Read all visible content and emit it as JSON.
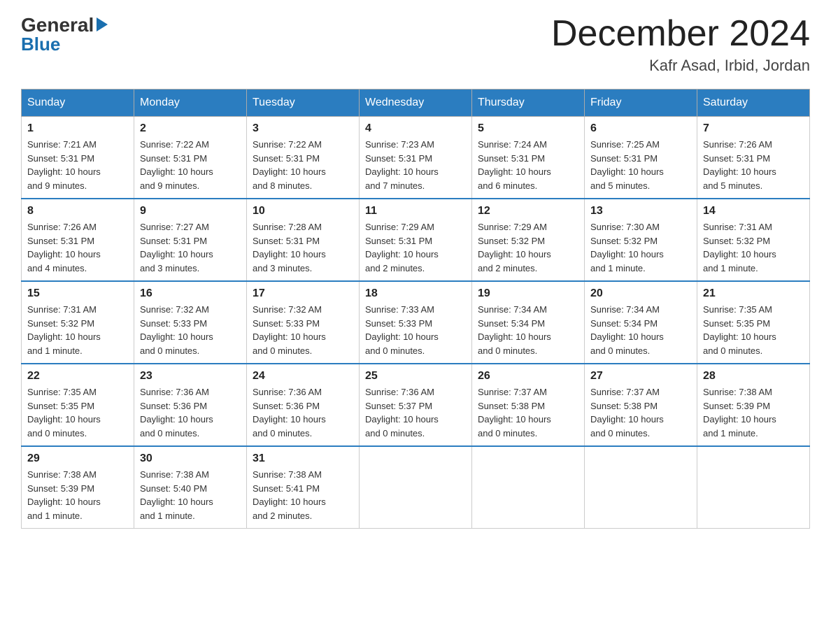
{
  "logo": {
    "general": "General",
    "blue": "Blue"
  },
  "title": "December 2024",
  "location": "Kafr Asad, Irbid, Jordan",
  "days_of_week": [
    "Sunday",
    "Monday",
    "Tuesday",
    "Wednesday",
    "Thursday",
    "Friday",
    "Saturday"
  ],
  "weeks": [
    [
      {
        "day": "1",
        "sunrise": "7:21 AM",
        "sunset": "5:31 PM",
        "daylight": "10 hours and 9 minutes."
      },
      {
        "day": "2",
        "sunrise": "7:22 AM",
        "sunset": "5:31 PM",
        "daylight": "10 hours and 9 minutes."
      },
      {
        "day": "3",
        "sunrise": "7:22 AM",
        "sunset": "5:31 PM",
        "daylight": "10 hours and 8 minutes."
      },
      {
        "day": "4",
        "sunrise": "7:23 AM",
        "sunset": "5:31 PM",
        "daylight": "10 hours and 7 minutes."
      },
      {
        "day": "5",
        "sunrise": "7:24 AM",
        "sunset": "5:31 PM",
        "daylight": "10 hours and 6 minutes."
      },
      {
        "day": "6",
        "sunrise": "7:25 AM",
        "sunset": "5:31 PM",
        "daylight": "10 hours and 5 minutes."
      },
      {
        "day": "7",
        "sunrise": "7:26 AM",
        "sunset": "5:31 PM",
        "daylight": "10 hours and 5 minutes."
      }
    ],
    [
      {
        "day": "8",
        "sunrise": "7:26 AM",
        "sunset": "5:31 PM",
        "daylight": "10 hours and 4 minutes."
      },
      {
        "day": "9",
        "sunrise": "7:27 AM",
        "sunset": "5:31 PM",
        "daylight": "10 hours and 3 minutes."
      },
      {
        "day": "10",
        "sunrise": "7:28 AM",
        "sunset": "5:31 PM",
        "daylight": "10 hours and 3 minutes."
      },
      {
        "day": "11",
        "sunrise": "7:29 AM",
        "sunset": "5:31 PM",
        "daylight": "10 hours and 2 minutes."
      },
      {
        "day": "12",
        "sunrise": "7:29 AM",
        "sunset": "5:32 PM",
        "daylight": "10 hours and 2 minutes."
      },
      {
        "day": "13",
        "sunrise": "7:30 AM",
        "sunset": "5:32 PM",
        "daylight": "10 hours and 1 minute."
      },
      {
        "day": "14",
        "sunrise": "7:31 AM",
        "sunset": "5:32 PM",
        "daylight": "10 hours and 1 minute."
      }
    ],
    [
      {
        "day": "15",
        "sunrise": "7:31 AM",
        "sunset": "5:32 PM",
        "daylight": "10 hours and 1 minute."
      },
      {
        "day": "16",
        "sunrise": "7:32 AM",
        "sunset": "5:33 PM",
        "daylight": "10 hours and 0 minutes."
      },
      {
        "day": "17",
        "sunrise": "7:32 AM",
        "sunset": "5:33 PM",
        "daylight": "10 hours and 0 minutes."
      },
      {
        "day": "18",
        "sunrise": "7:33 AM",
        "sunset": "5:33 PM",
        "daylight": "10 hours and 0 minutes."
      },
      {
        "day": "19",
        "sunrise": "7:34 AM",
        "sunset": "5:34 PM",
        "daylight": "10 hours and 0 minutes."
      },
      {
        "day": "20",
        "sunrise": "7:34 AM",
        "sunset": "5:34 PM",
        "daylight": "10 hours and 0 minutes."
      },
      {
        "day": "21",
        "sunrise": "7:35 AM",
        "sunset": "5:35 PM",
        "daylight": "10 hours and 0 minutes."
      }
    ],
    [
      {
        "day": "22",
        "sunrise": "7:35 AM",
        "sunset": "5:35 PM",
        "daylight": "10 hours and 0 minutes."
      },
      {
        "day": "23",
        "sunrise": "7:36 AM",
        "sunset": "5:36 PM",
        "daylight": "10 hours and 0 minutes."
      },
      {
        "day": "24",
        "sunrise": "7:36 AM",
        "sunset": "5:36 PM",
        "daylight": "10 hours and 0 minutes."
      },
      {
        "day": "25",
        "sunrise": "7:36 AM",
        "sunset": "5:37 PM",
        "daylight": "10 hours and 0 minutes."
      },
      {
        "day": "26",
        "sunrise": "7:37 AM",
        "sunset": "5:38 PM",
        "daylight": "10 hours and 0 minutes."
      },
      {
        "day": "27",
        "sunrise": "7:37 AM",
        "sunset": "5:38 PM",
        "daylight": "10 hours and 0 minutes."
      },
      {
        "day": "28",
        "sunrise": "7:38 AM",
        "sunset": "5:39 PM",
        "daylight": "10 hours and 1 minute."
      }
    ],
    [
      {
        "day": "29",
        "sunrise": "7:38 AM",
        "sunset": "5:39 PM",
        "daylight": "10 hours and 1 minute."
      },
      {
        "day": "30",
        "sunrise": "7:38 AM",
        "sunset": "5:40 PM",
        "daylight": "10 hours and 1 minute."
      },
      {
        "day": "31",
        "sunrise": "7:38 AM",
        "sunset": "5:41 PM",
        "daylight": "10 hours and 2 minutes."
      },
      null,
      null,
      null,
      null
    ]
  ],
  "labels": {
    "sunrise": "Sunrise:",
    "sunset": "Sunset:",
    "daylight": "Daylight:"
  }
}
